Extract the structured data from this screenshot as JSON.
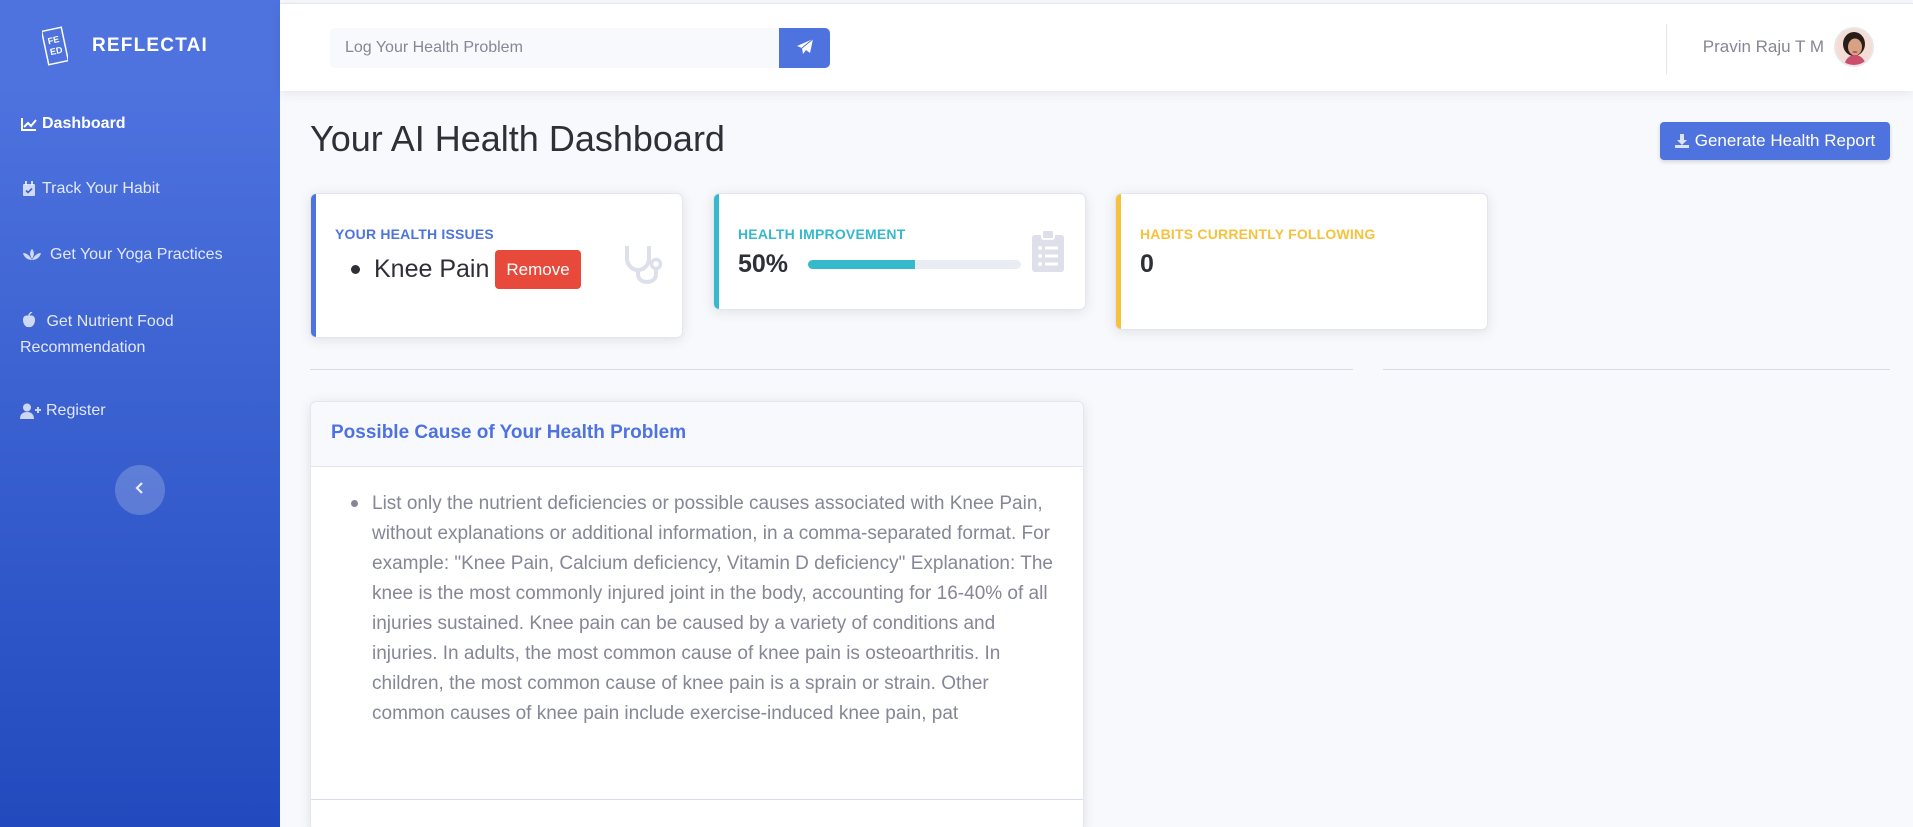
{
  "app": {
    "brand": "REFLECTAI",
    "logo_text": "FEED"
  },
  "sidebar": {
    "items": [
      {
        "label": "Dashboard",
        "icon": "chart-line-icon",
        "active": true
      },
      {
        "label": "Track Your Habit",
        "icon": "calendar-check-icon"
      },
      {
        "label": "Get Your Yoga Practices",
        "icon": "lotus-icon"
      },
      {
        "label": "Get Nutrient Food Recommendation",
        "icon": "apple-icon"
      },
      {
        "label": "Register",
        "icon": "user-plus-icon"
      }
    ],
    "toggle_icon": "chevron-left-icon"
  },
  "topbar": {
    "search_placeholder": "Log Your Health Problem",
    "search_button_icon": "paper-plane-icon",
    "user_name": "Pravin Raju T M"
  },
  "header": {
    "title": "Your AI Health Dashboard",
    "report_button": "Generate Health Report"
  },
  "cards": {
    "issues": {
      "label": "Your Health Issues",
      "items": [
        "Knee Pain"
      ],
      "remove_label": "Remove",
      "color": "#4e73df",
      "icon": "stethoscope-icon"
    },
    "improvement": {
      "label": "Health Improvement",
      "value": "50%",
      "progress": 0.5,
      "color": "#36b9cc",
      "icon": "clipboard-list-icon"
    },
    "habits": {
      "label": "Habits Currently Following",
      "value": "0",
      "color": "#f6c23e"
    }
  },
  "cause": {
    "title": "Possible Cause of Your Health Problem",
    "text": "List only the nutrient deficiencies or possible causes associated with Knee Pain, without explanations or additional information, in a comma-separated format. For example: \"Knee Pain, Calcium deficiency, Vitamin D deficiency\" Explanation: The knee is the most commonly injured joint in the body, accounting for 16-40% of all injuries sustained. Knee pain can be caused by a variety of conditions and injuries. In adults, the most common cause of knee pain is osteoarthritis. In children, the most common cause of knee pain is a sprain or strain. Other common causes of knee pain include exercise-induced knee pain, pat"
  },
  "colors": {
    "primary": "#4e73df",
    "info": "#36b9cc",
    "warning": "#f6c23e",
    "danger": "#e74a3b"
  }
}
